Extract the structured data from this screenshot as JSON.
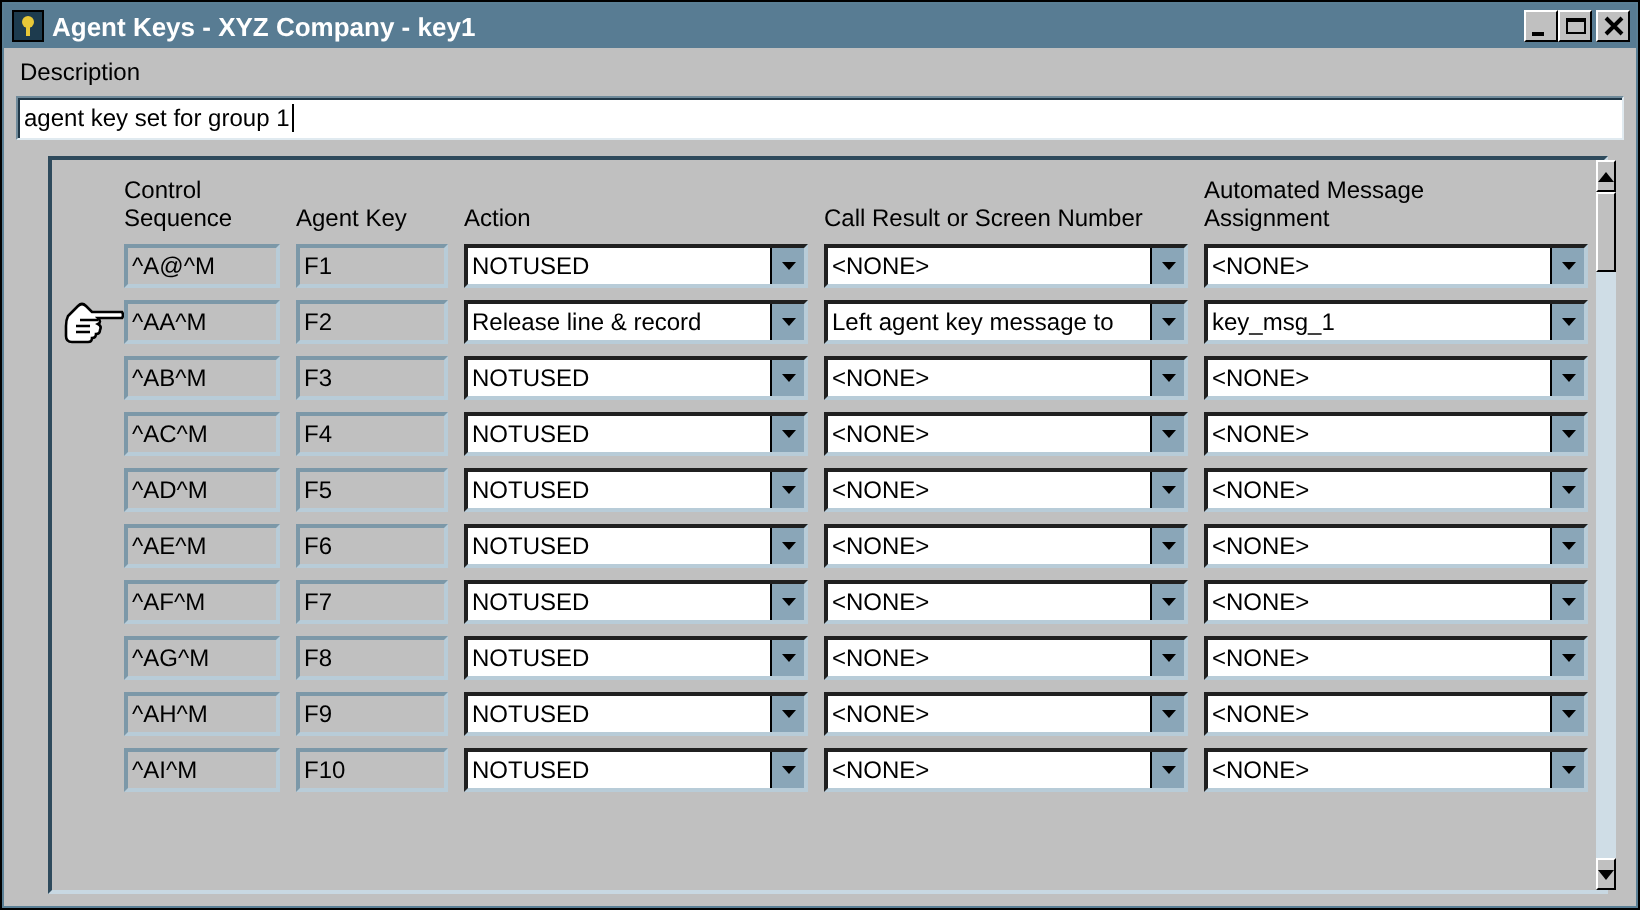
{
  "window": {
    "title": "Agent Keys - XYZ Company - key1"
  },
  "description": {
    "label": "Description",
    "value": "agent key set for group 1"
  },
  "table": {
    "columns": [
      "Control\nSequence",
      "Agent Key",
      "Action",
      "Call Result or Screen Number",
      "Automated Message\nAssignment"
    ],
    "rows": [
      {
        "control_sequence": "^A@^M",
        "agent_key": "F1",
        "action": "NOTUSED",
        "call_result": "<NONE>",
        "message": "<NONE>",
        "selected": false
      },
      {
        "control_sequence": "^AA^M",
        "agent_key": "F2",
        "action": "Release line & record",
        "call_result": "Left agent key message to",
        "message": "key_msg_1",
        "selected": true
      },
      {
        "control_sequence": "^AB^M",
        "agent_key": "F3",
        "action": "NOTUSED",
        "call_result": "<NONE>",
        "message": "<NONE>",
        "selected": false
      },
      {
        "control_sequence": "^AC^M",
        "agent_key": "F4",
        "action": "NOTUSED",
        "call_result": "<NONE>",
        "message": "<NONE>",
        "selected": false
      },
      {
        "control_sequence": "^AD^M",
        "agent_key": "F5",
        "action": "NOTUSED",
        "call_result": "<NONE>",
        "message": "<NONE>",
        "selected": false
      },
      {
        "control_sequence": "^AE^M",
        "agent_key": "F6",
        "action": "NOTUSED",
        "call_result": "<NONE>",
        "message": "<NONE>",
        "selected": false
      },
      {
        "control_sequence": "^AF^M",
        "agent_key": "F7",
        "action": "NOTUSED",
        "call_result": "<NONE>",
        "message": "<NONE>",
        "selected": false
      },
      {
        "control_sequence": "^AG^M",
        "agent_key": "F8",
        "action": "NOTUSED",
        "call_result": "<NONE>",
        "message": "<NONE>",
        "selected": false
      },
      {
        "control_sequence": "^AH^M",
        "agent_key": "F9",
        "action": "NOTUSED",
        "call_result": "<NONE>",
        "message": "<NONE>",
        "selected": false
      },
      {
        "control_sequence": "^AI^M",
        "agent_key": "F10",
        "action": "NOTUSED",
        "call_result": "<NONE>",
        "message": "<NONE>",
        "selected": false
      }
    ]
  }
}
